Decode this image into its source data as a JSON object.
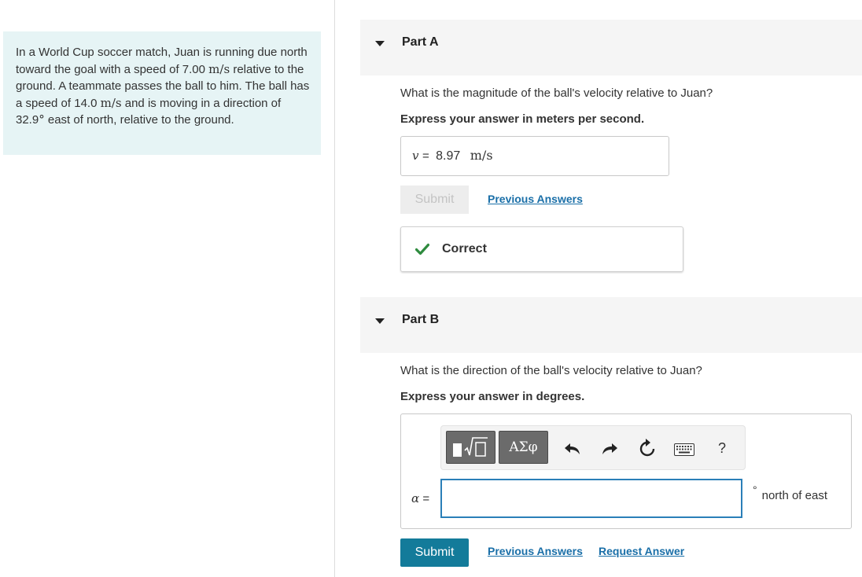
{
  "problem": {
    "text_1": "In a World Cup soccer match, Juan is running due north toward the goal with a speed of 7.00",
    "unit_1": "m/s",
    "text_2": "relative to the ground. A teammate passes the ball to him. The ball has a speed of 14.0",
    "unit_2": "m/s",
    "text_3": "and is moving in a direction of 32.9",
    "deg": "°",
    "text_4": "east of north, relative to the ground."
  },
  "part_a": {
    "title": "Part A",
    "question": "What is the magnitude of the ball's velocity relative to Juan?",
    "instruction": "Express your answer in meters per second.",
    "answer_var": "v",
    "equals": "=",
    "answer_value": "8.97",
    "answer_unit": "m/s",
    "submit_label": "Submit",
    "previous_answers_label": "Previous Answers",
    "feedback": "Correct",
    "colors": {
      "check": "#2e8b3e"
    }
  },
  "part_b": {
    "title": "Part B",
    "question": "What is the direction of the ball's velocity relative to Juan?",
    "instruction": "Express your answer in degrees.",
    "greek_label": "ΑΣφ",
    "help_label": "?",
    "input_var": "α",
    "equals": "=",
    "input_value": "",
    "unit_deg": "°",
    "unit_text": "north of east",
    "submit_label": "Submit",
    "previous_answers_label": "Previous Answers",
    "request_answer_label": "Request Answer",
    "toolbar_icons": [
      "templates-icon",
      "greek-symbols-icon",
      "undo-icon",
      "redo-icon",
      "reset-icon",
      "keyboard-icon",
      "help-icon"
    ]
  },
  "colors": {
    "problem_bg": "#e6f4f5",
    "part_header_bg": "#f5f5f5",
    "submit_bg": "#137b9a",
    "link": "#1a6fa8",
    "input_border": "#2a7fb8"
  }
}
